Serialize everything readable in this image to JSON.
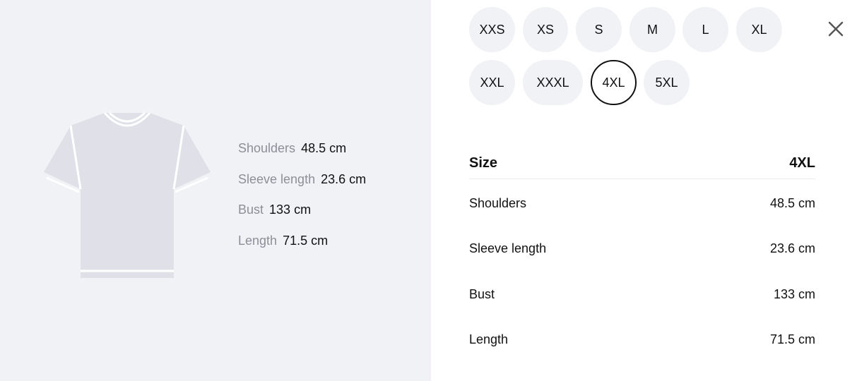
{
  "left": {
    "measurements": [
      {
        "label": "Shoulders",
        "value": "48.5 cm"
      },
      {
        "label": "Sleeve length",
        "value": "23.6 cm"
      },
      {
        "label": "Bust",
        "value": "133 cm"
      },
      {
        "label": "Length",
        "value": "71.5 cm"
      }
    ]
  },
  "sizes": [
    "XXS",
    "XS",
    "S",
    "M",
    "L",
    "XL",
    "XXL",
    "XXXL",
    "4XL",
    "5XL"
  ],
  "selected_size": "4XL",
  "close_icon": "close-icon",
  "table": {
    "header_label": "Size",
    "header_value": "4XL",
    "rows": [
      {
        "label": "Shoulders",
        "value": "48.5 cm"
      },
      {
        "label": "Sleeve length",
        "value": "23.6 cm"
      },
      {
        "label": "Bust",
        "value": "133 cm"
      },
      {
        "label": "Length",
        "value": "71.5 cm"
      }
    ]
  },
  "colors": {
    "panel_bg": "#f1f2f6",
    "chip_bg": "#f1f2f6",
    "selected_border": "#111111",
    "muted_text": "#8e8e98",
    "tshirt_fill": "#dfe0e8"
  }
}
